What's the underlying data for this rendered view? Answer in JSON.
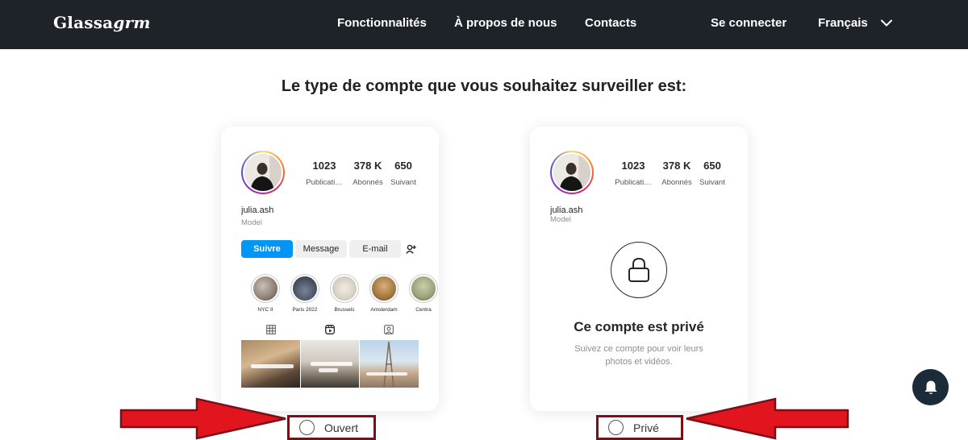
{
  "nav": {
    "logo_main": "Glassa",
    "logo_italic": "grm",
    "links": [
      "Fonctionnalités",
      "À propos de nous",
      "Contacts"
    ],
    "login": "Se connecter",
    "language": "Français"
  },
  "heading": "Le type de compte que vous souhaitez surveiller est:",
  "profile": {
    "username": "julia.ash",
    "subtitle": "Model",
    "stats": [
      {
        "value": "1023",
        "label": "Publicati…"
      },
      {
        "value": "378 K",
        "label": "Abonnés"
      },
      {
        "value": "650",
        "label": "Suivant"
      }
    ]
  },
  "open_card": {
    "buttons": {
      "follow": "Suivre",
      "message": "Message",
      "email": "E-mail"
    },
    "highlights": [
      {
        "label": "NYC II",
        "color": "#8e7f73"
      },
      {
        "label": "Paris 2022",
        "color": "#4b5567"
      },
      {
        "label": "Brussels",
        "color": "#d8d0c4"
      },
      {
        "label": "Amsterdam",
        "color": "#a2783f"
      },
      {
        "label": "Centra",
        "color": "#9aa27a"
      }
    ],
    "tab_icons": [
      "grid-icon",
      "reels-icon",
      "tagged-icon"
    ]
  },
  "private_card": {
    "title": "Ce compte est privé",
    "description": "Suivez ce compte pour voir leurs photos et vidéos."
  },
  "options": {
    "open_label": "Ouvert",
    "private_label": "Privé"
  },
  "colors": {
    "nav_bg": "#1e2229",
    "accent_blue": "#0095f6",
    "arrow_red": "#e2151f",
    "option_border": "#7a0f1a",
    "fab_bg": "#1c2b3a"
  }
}
